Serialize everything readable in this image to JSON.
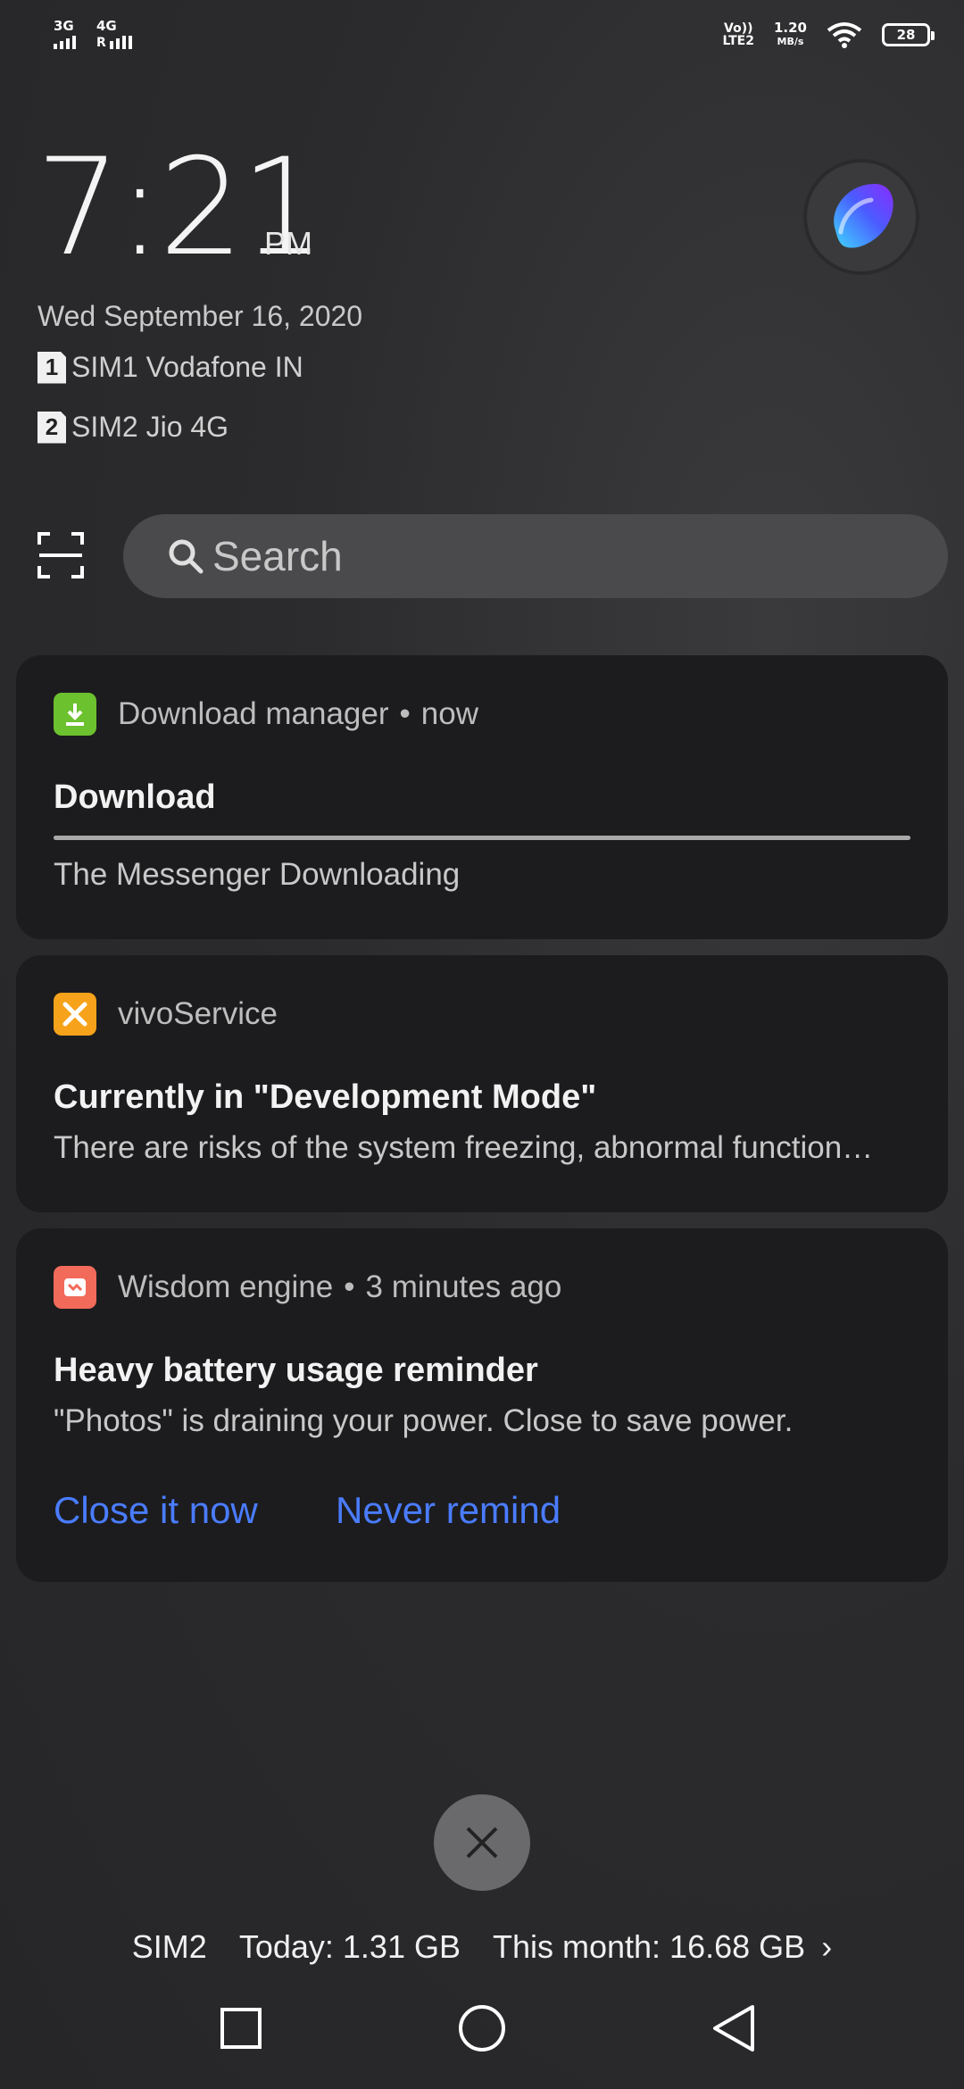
{
  "status_bar": {
    "sim1_network": "3G",
    "sim2_network": "4G",
    "sim2_roaming": "R",
    "volte": [
      "Vo))",
      "LTE2"
    ],
    "speed_value": "1.20",
    "speed_unit": "MB/s",
    "battery_level": "28"
  },
  "lockscreen": {
    "time": "7:21",
    "ampm": "PM",
    "date": "Wed September 16, 2020",
    "sims": [
      {
        "badge": "1",
        "label": "SIM1 Vodafone IN"
      },
      {
        "badge": "2",
        "label": "SIM2 Jio 4G"
      }
    ]
  },
  "search": {
    "placeholder": "Search"
  },
  "notifications": [
    {
      "app": "Download manager",
      "time": "now",
      "icon": "download-icon",
      "icon_color": "#6cc12e",
      "title": "Download",
      "progress_fraction": 1.0,
      "body": "The Messenger Downloading"
    },
    {
      "app": "vivoService",
      "icon": "tools-icon",
      "icon_color": "#f7a21b",
      "title": "Currently in \"Development Mode\"",
      "body": "There are risks of the system freezing, abnormal function…"
    },
    {
      "app": "Wisdom engine",
      "time": "3 minutes ago",
      "icon": "wisdom-engine-icon",
      "icon_color": "#f26a5a",
      "title": "Heavy battery usage reminder",
      "body": "\"Photos\" is draining your power. Close to save power.",
      "actions": [
        "Close it now",
        "Never remind"
      ]
    }
  ],
  "data_usage": {
    "sim": "SIM2",
    "today": "Today: 1.31 GB",
    "month": "This month: 16.68 GB",
    "chevron": "›"
  },
  "colors": {
    "accent": "#4a7cff",
    "card_bg": "#1c1c1e"
  }
}
